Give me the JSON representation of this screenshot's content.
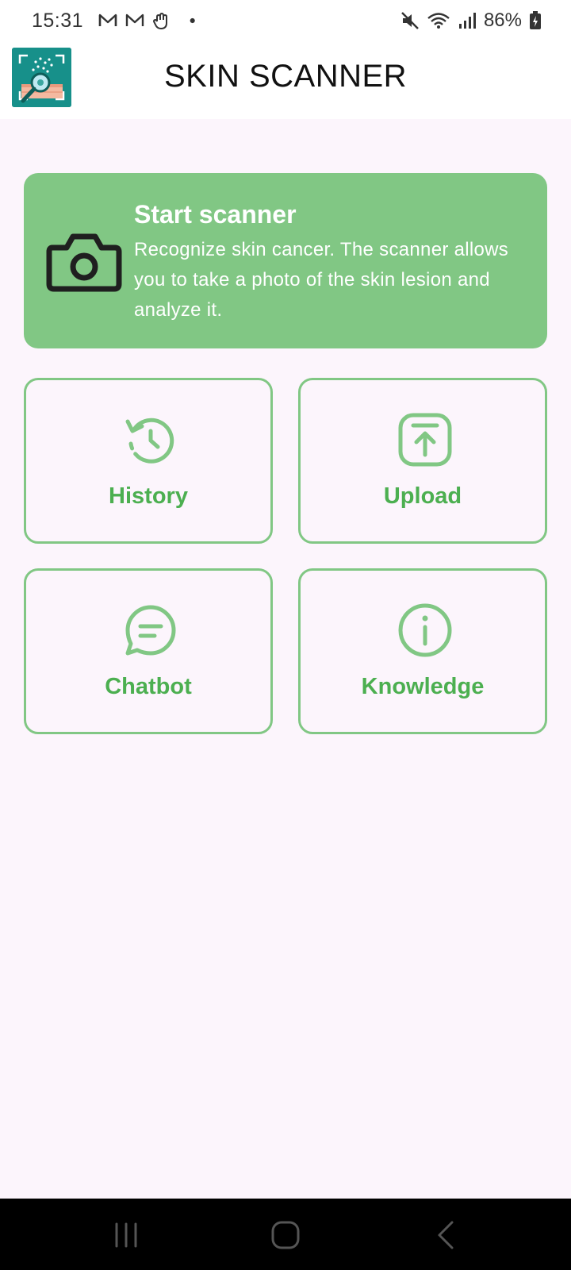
{
  "status_bar": {
    "time": "15:31",
    "battery_percent": "86%",
    "notification_icons": [
      "gmail-icon",
      "gmail-icon",
      "hand-wave-icon",
      "dot-icon"
    ],
    "system_icons": [
      "mute-icon",
      "wifi-icon",
      "signal-icon",
      "battery-icon"
    ]
  },
  "app_bar": {
    "title": "SKIN SCANNER",
    "logo_icon": "skin-scanner-logo"
  },
  "scanner_card": {
    "title": "Start scanner",
    "description": "Recognize skin cancer. The scanner allows you to take a photo of the skin lesion and analyze it.",
    "icon": "camera-icon"
  },
  "tiles": [
    {
      "label": "History",
      "icon": "history-icon"
    },
    {
      "label": "Upload",
      "icon": "upload-icon"
    },
    {
      "label": "Chatbot",
      "icon": "chat-icon"
    },
    {
      "label": "Knowledge",
      "icon": "info-icon"
    }
  ],
  "colors": {
    "accent": "#81C784",
    "accent_text": "#4CAF50",
    "background": "#FCF5FC"
  },
  "nav_bar": {
    "icons": [
      "recent-apps-icon",
      "home-icon",
      "back-icon"
    ]
  }
}
